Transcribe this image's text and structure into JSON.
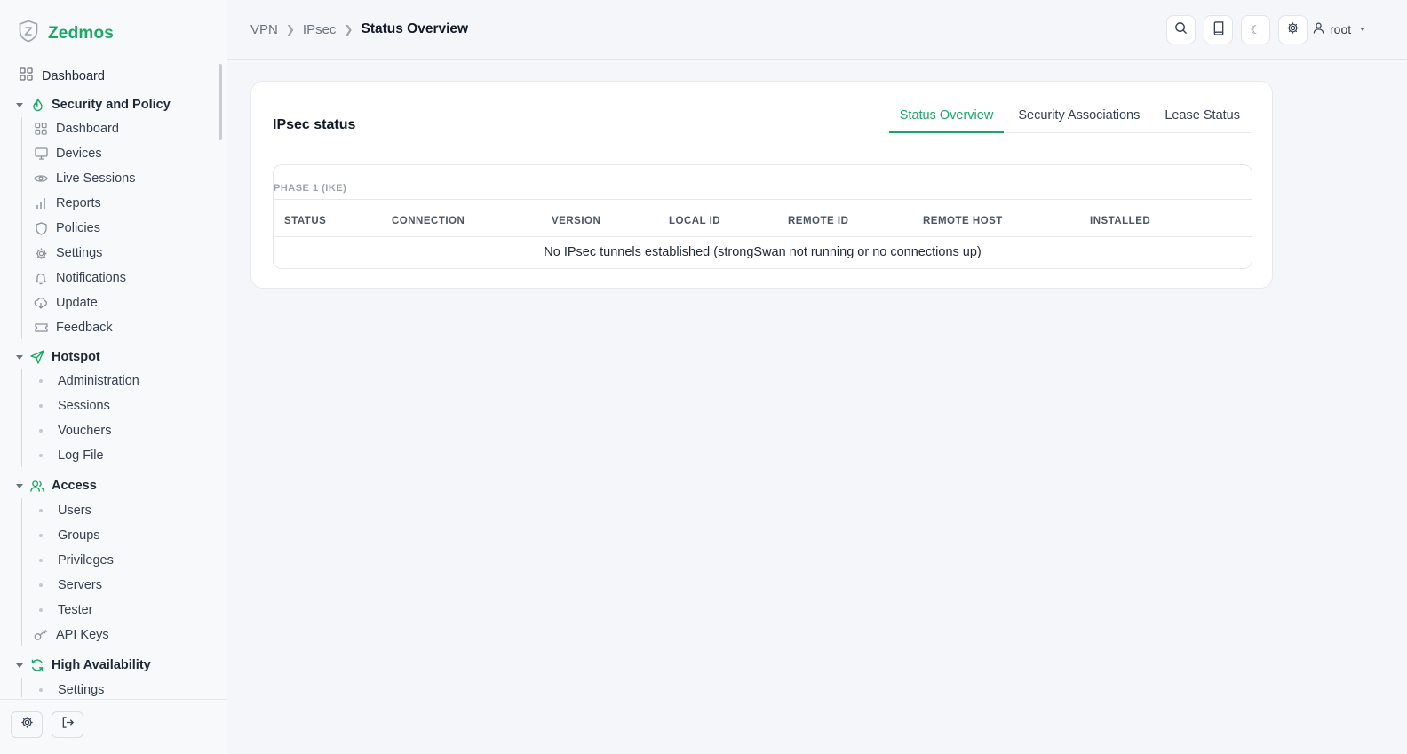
{
  "brand": {
    "name": "Zedmos",
    "logo_icon": "shield-z-icon"
  },
  "sidebar": {
    "top_item": {
      "label": "Dashboard",
      "icon": "grid-icon"
    },
    "sections": [
      {
        "title": "Security and Policy",
        "icon": "flame-icon",
        "items": [
          {
            "label": "Dashboard",
            "icon": "grid-icon"
          },
          {
            "label": "Devices",
            "icon": "monitor-icon"
          },
          {
            "label": "Live Sessions",
            "icon": "eye-icon"
          },
          {
            "label": "Reports",
            "icon": "bar-chart-icon"
          },
          {
            "label": "Policies",
            "icon": "shield-icon"
          },
          {
            "label": "Settings",
            "icon": "gear-icon"
          },
          {
            "label": "Notifications",
            "icon": "bell-icon"
          },
          {
            "label": "Update",
            "icon": "cloud-download-icon"
          },
          {
            "label": "Feedback",
            "icon": "ticket-icon"
          }
        ]
      },
      {
        "title": "Hotspot",
        "icon": "send-icon",
        "items": [
          {
            "label": "Administration"
          },
          {
            "label": "Sessions"
          },
          {
            "label": "Vouchers"
          },
          {
            "label": "Log File"
          }
        ]
      },
      {
        "title": "Access",
        "icon": "users-icon",
        "items": [
          {
            "label": "Users"
          },
          {
            "label": "Groups"
          },
          {
            "label": "Privileges"
          },
          {
            "label": "Servers"
          },
          {
            "label": "Tester"
          },
          {
            "label": "API Keys",
            "icon": "key-icon"
          }
        ]
      },
      {
        "title": "High Availability",
        "icon": "refresh-icon",
        "items": [
          {
            "label": "Settings"
          }
        ]
      }
    ],
    "footer": {
      "settings_icon": "gear-icon",
      "logout_icon": "logout-icon"
    }
  },
  "header": {
    "breadcrumb": [
      "VPN",
      "IPsec",
      "Status Overview"
    ],
    "buttons": [
      "search-icon",
      "book-icon",
      "moon-icon",
      "gear-icon"
    ],
    "user": {
      "name": "root",
      "icon": "user-icon"
    }
  },
  "main": {
    "card_title": "IPsec status",
    "tabs": [
      {
        "label": "Status Overview",
        "active": true
      },
      {
        "label": "Security Associations",
        "active": false
      },
      {
        "label": "Lease Status",
        "active": false
      }
    ],
    "phase_label": "PHASE 1 (IKE)",
    "columns": [
      "STATUS",
      "CONNECTION",
      "VERSION",
      "LOCAL ID",
      "REMOTE ID",
      "REMOTE HOST",
      "INSTALLED"
    ],
    "empty_message": "No IPsec tunnels established (strongSwan not running or no connections up)"
  },
  "colors": {
    "accent": "#17a864",
    "text": "#1f2937",
    "muted": "#6b7280",
    "background": "#f4f6f9"
  }
}
